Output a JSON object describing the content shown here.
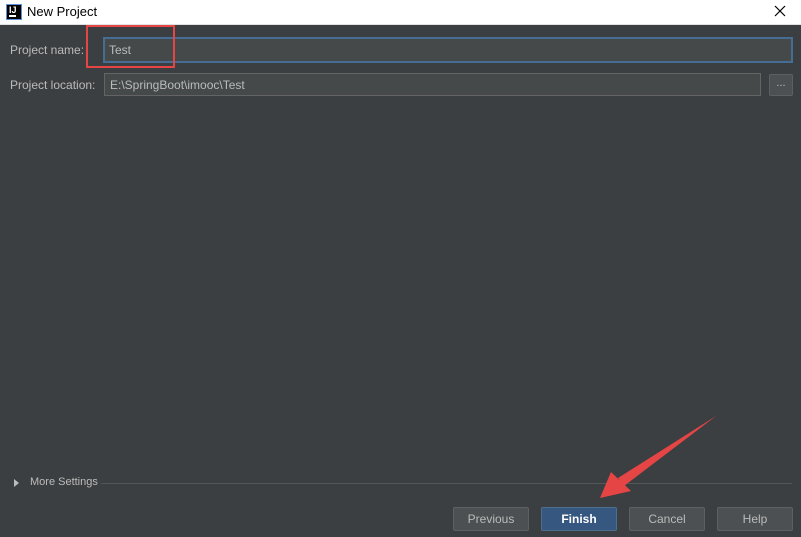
{
  "window": {
    "title": "New Project"
  },
  "form": {
    "project_name": {
      "label": "Project name:",
      "value": "Test"
    },
    "project_location": {
      "label": "Project location:",
      "value": "E:\\SpringBoot\\imooc\\Test",
      "browse_label": "..."
    }
  },
  "more_settings": {
    "label": "More Settings"
  },
  "footer": {
    "previous_label": "Previous",
    "finish_label": "Finish",
    "cancel_label": "Cancel",
    "help_label": "Help"
  },
  "colors": {
    "background": "#3c3f41",
    "primary_button": "#365880",
    "annotation_red": "#e64545"
  },
  "icons": {
    "app": "intellij-icon",
    "close": "close-icon",
    "expand": "triangle-right-icon"
  }
}
